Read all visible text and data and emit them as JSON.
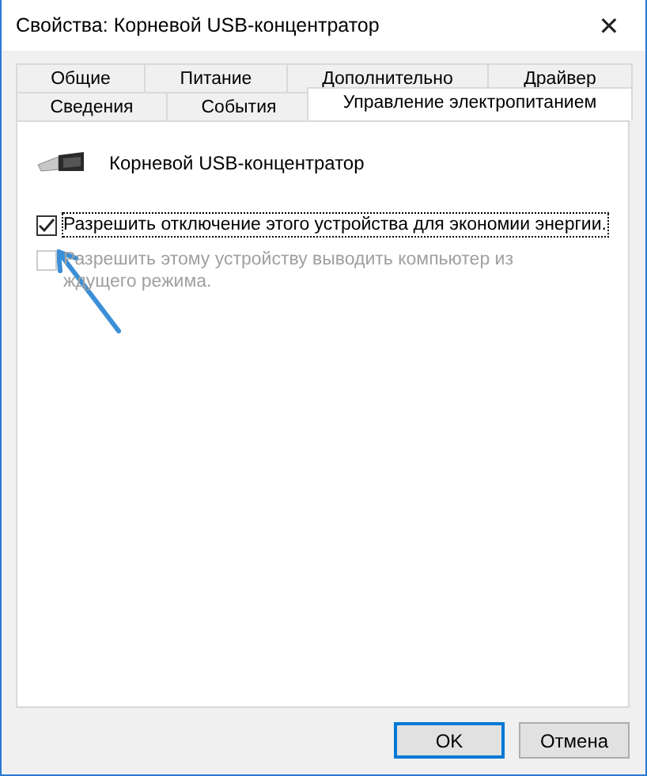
{
  "window": {
    "title": "Свойства: Корневой USB-концентратор",
    "close": "✕"
  },
  "tab_rows": [
    [
      {
        "label": "Общие",
        "selected": false
      },
      {
        "label": "Питание",
        "selected": false
      },
      {
        "label": "Дополнительно",
        "selected": false
      },
      {
        "label": "Драйвер",
        "selected": false
      }
    ],
    [
      {
        "label": "Сведения",
        "selected": false
      },
      {
        "label": "События",
        "selected": false
      },
      {
        "label": "Управление электропитанием",
        "selected": true
      }
    ]
  ],
  "device": {
    "name": "Корневой USB-концентратор"
  },
  "options": [
    {
      "label": "Разрешить отключение этого устройства для экономии энергии.",
      "checked": true,
      "disabled": false
    },
    {
      "label": "Разрешить этому устройству выводить компьютер из ждущего режима.",
      "checked": false,
      "disabled": true
    }
  ],
  "buttons": [
    {
      "label": "OK",
      "default": true
    },
    {
      "label": "Отмена",
      "default": false
    }
  ]
}
